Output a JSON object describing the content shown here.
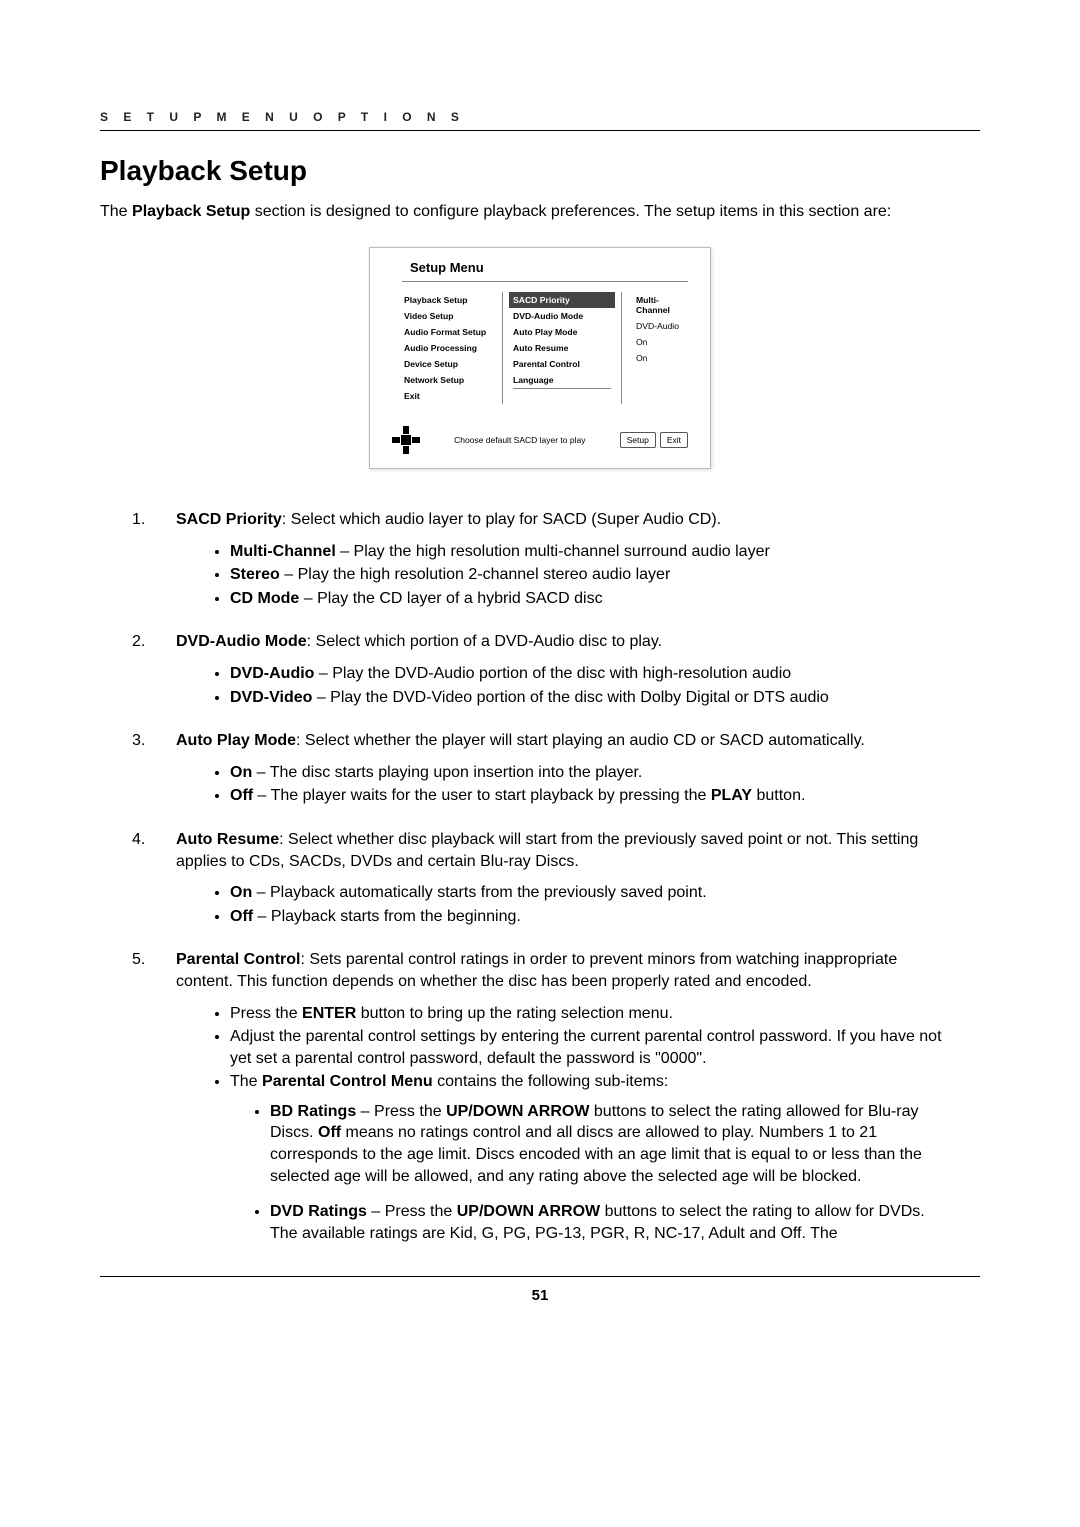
{
  "header": {
    "running": "S E T U P   M E N U   O P T I O N S"
  },
  "title": "Playback Setup",
  "intro_prefix": "The ",
  "intro_bold": "Playback Setup",
  "intro_suffix": " section is designed to configure playback preferences. The setup items in this section are:",
  "shot": {
    "title": "Setup Menu",
    "left": [
      "Playback Setup",
      "Video Setup",
      "Audio Format Setup",
      "Audio Processing",
      "Device Setup",
      "Network Setup",
      "Exit"
    ],
    "mid_hl": "SACD Priority",
    "mid": [
      "DVD-Audio Mode",
      "Auto Play Mode",
      "Auto Resume",
      "Parental Control",
      "Language"
    ],
    "right_hl": "Multi-Channel",
    "right": [
      "DVD-Audio",
      "On",
      "On"
    ],
    "hint": "Choose default SACD layer to play",
    "chip1": "Setup",
    "chip2": "Exit"
  },
  "i1": {
    "num": "1.",
    "bold": "SACD Priority",
    "rest": ": Select which audio layer to play for SACD (Super Audio CD).",
    "b1b": "Multi-Channel",
    "b1r": " – Play the high resolution multi-channel surround audio layer",
    "b2b": "Stereo",
    "b2r": " – Play the high resolution 2-channel stereo audio layer",
    "b3b": "CD Mode",
    "b3r": " – Play the CD layer of a hybrid SACD disc"
  },
  "i2": {
    "num": "2.",
    "bold": "DVD-Audio Mode",
    "rest": ": Select which portion of a DVD-Audio disc to play.",
    "b1b": "DVD-Audio",
    "b1r": " – Play the DVD-Audio portion of the disc with high-resolution audio",
    "b2b": "DVD-Video",
    "b2r": " – Play the DVD-Video portion of the disc with Dolby Digital or DTS audio"
  },
  "i3": {
    "num": "3.",
    "bold": "Auto Play Mode",
    "rest": ": Select whether the player will start playing an audio CD or SACD automatically.",
    "b1b": "On",
    "b1r": " – The disc starts playing upon insertion into the player.",
    "b2b": "Off",
    "b2p1": " – The player waits for the user to start playback by pressing the ",
    "b2bold": "PLAY",
    "b2p2": " button."
  },
  "i4": {
    "num": "4.",
    "bold": "Auto Resume",
    "rest": ": Select whether disc playback will start from the previously saved point or not. This setting applies to CDs, SACDs, DVDs and certain Blu-ray Discs.",
    "b1b": "On",
    "b1r": " – Playback automatically starts from the previously saved point.",
    "b2b": "Off",
    "b2r": " – Playback starts from the beginning."
  },
  "i5": {
    "num": "5.",
    "bold": "Parental Control",
    "rest": ": Sets parental control ratings in order to prevent minors from watching inappropriate content. This function depends on whether the disc has been properly rated and encoded.",
    "b1p1": "Press the ",
    "b1bold": "ENTER",
    "b1p2": " button to bring up the rating selection menu.",
    "b2": "Adjust the parental control settings by entering the current parental control password. If you have not yet set a parental control password, default the password is \"0000\".",
    "b3p1": "The ",
    "b3bold": "Parental Control Menu",
    "b3p2": " contains the following sub-items:",
    "s1b": "BD Ratings",
    "s1p1": " – Press the ",
    "s1bold": "UP/DOWN ARROW",
    "s1p2": " buttons to select the rating allowed for Blu-ray Discs. ",
    "s1off": "Off",
    "s1p3": " means no ratings control and all discs are allowed to play. Numbers 1 to 21 corresponds to the age limit. Discs encoded with an age limit that is equal to or less than the selected age will be allowed, and any rating above the selected age will be blocked.",
    "s2b": "DVD Ratings",
    "s2p1": " – Press the ",
    "s2bold": "UP/DOWN ARROW",
    "s2p2": " buttons to select the rating to allow for DVDs. The available ratings are Kid, G, PG, PG-13, PGR, R, NC-17, Adult and Off. The"
  },
  "page_number": "51"
}
